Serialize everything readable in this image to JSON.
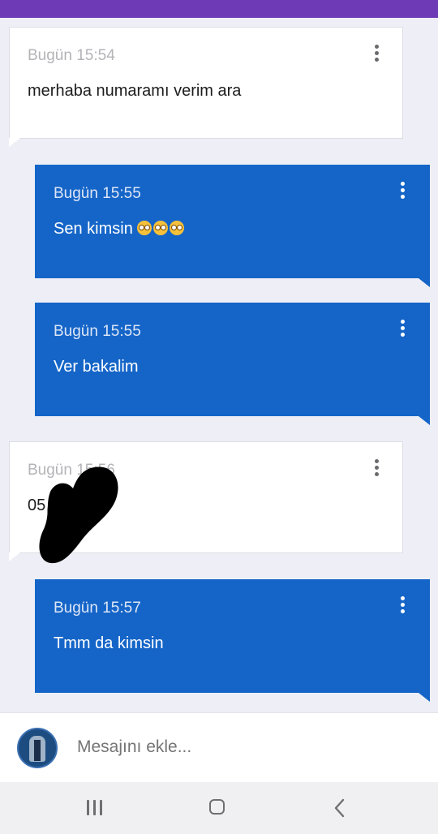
{
  "status_bar_color": "#6e3ab5",
  "messages": [
    {
      "direction": "incoming",
      "time": "Bugün 15:54",
      "text": "merhaba numaramı verim ara",
      "menu_icon": "more-vert-icon"
    },
    {
      "direction": "outgoing",
      "time": "Bugün 15:55",
      "text": "Sen kimsin",
      "emojis": [
        "flushed-face-emoji",
        "flushed-face-emoji",
        "rolling-eyes-emoji"
      ],
      "menu_icon": "more-vert-icon"
    },
    {
      "direction": "outgoing",
      "time": "Bugün 15:55",
      "text": "Ver bakalim",
      "menu_icon": "more-vert-icon"
    },
    {
      "direction": "incoming",
      "time": "Bugün 15:56",
      "text": "05         4",
      "redacted": true,
      "menu_icon": "more-vert-icon"
    },
    {
      "direction": "outgoing",
      "time": "Bugün 15:57",
      "text": "Tmm da kimsin",
      "menu_icon": "more-vert-icon"
    }
  ],
  "composer": {
    "placeholder": "Mesajını ekle...",
    "avatar_icon": "user-avatar"
  },
  "navbar": {
    "recent_icon": "recent-apps-icon",
    "home_icon": "home-icon",
    "back_icon": "back-icon"
  },
  "colors": {
    "incoming_bg": "#ffffff",
    "outgoing_bg": "#1565c8",
    "background": "#eeeff6"
  }
}
